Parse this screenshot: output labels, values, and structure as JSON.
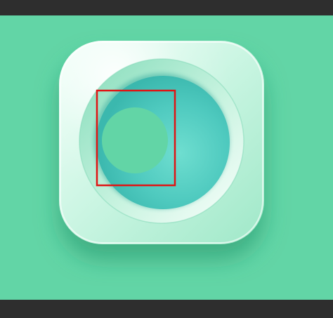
{
  "colors": {
    "background": "#62d5a6",
    "frame": "#2e2e2e",
    "tile_light": "#eafff6",
    "tile_mid": "#c9f6e2",
    "tile_edge": "#9fe8c8",
    "ring_outer": "#8fe1c1",
    "ring_inner": "#f5fffb",
    "bowl_center": "#64d8c8",
    "bowl_edge": "#3fbfb5",
    "inner_dot": "#62d5a6",
    "selection": "#e01414"
  },
  "icons": {
    "app_icon": "rounded-square-app-icon",
    "bowl": "circular-bowl",
    "dot": "inner-circle-dot",
    "selection": "selection-rectangle"
  }
}
